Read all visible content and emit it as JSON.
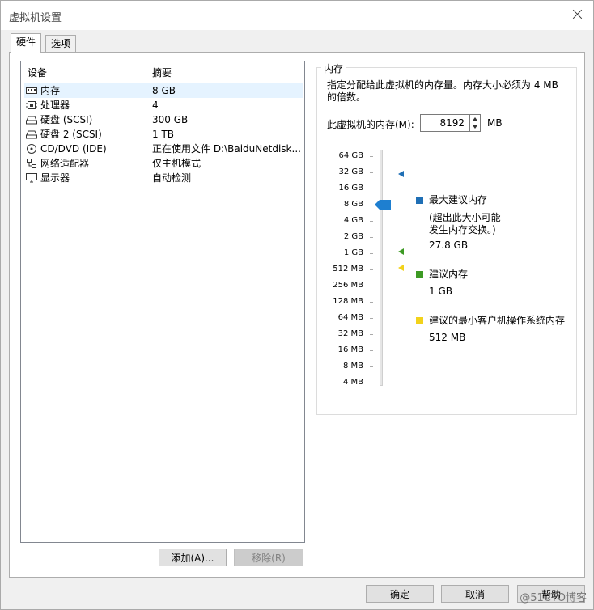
{
  "window": {
    "title": "虚拟机设置"
  },
  "tabs": [
    {
      "label": "硬件"
    },
    {
      "label": "选项"
    }
  ],
  "device_list": {
    "headers": {
      "device": "设备",
      "summary": "摘要"
    },
    "rows": [
      {
        "icon": "memory-icon",
        "device": "内存",
        "summary": "8 GB"
      },
      {
        "icon": "cpu-icon",
        "device": "处理器",
        "summary": "4"
      },
      {
        "icon": "disk-icon",
        "device": "硬盘 (SCSI)",
        "summary": "300 GB"
      },
      {
        "icon": "disk-icon",
        "device": "硬盘 2 (SCSI)",
        "summary": "1 TB"
      },
      {
        "icon": "cd-icon",
        "device": "CD/DVD (IDE)",
        "summary": "正在使用文件 D:\\BaiduNetdisk..."
      },
      {
        "icon": "network-icon",
        "device": "网络适配器",
        "summary": "仅主机模式"
      },
      {
        "icon": "display-icon",
        "device": "显示器",
        "summary": "自动检测"
      }
    ]
  },
  "list_buttons": {
    "add": "添加(A)...",
    "remove": "移除(R)"
  },
  "memory": {
    "group_title": "内存",
    "description": "指定分配给此虚拟机的内存量。内存大小必须为 4 MB 的倍数。",
    "label": "此虚拟机的内存(M):",
    "value": "8192",
    "unit": "MB",
    "scale_ticks": [
      "64 GB",
      "32 GB",
      "16 GB",
      "8 GB",
      "4 GB",
      "2 GB",
      "1 GB",
      "512 MB",
      "256 MB",
      "128 MB",
      "64 MB",
      "32 MB",
      "16 MB",
      "8 MB",
      "4 MB"
    ],
    "legend": {
      "max_title": "最大建议内存",
      "max_note_line1": "(超出此大小可能",
      "max_note_line2": "发生内存交换。)",
      "max_value": "27.8 GB",
      "rec_title": "建议内存",
      "rec_value": "1 GB",
      "min_title": "建议的最小客户机操作系统内存",
      "min_value": "512 MB"
    },
    "colors": {
      "max": "#1f6fb5",
      "recommended": "#3d9a24",
      "minimum": "#f2d21b",
      "thumb": "#1e7fd0"
    }
  },
  "footer": {
    "ok": "确定",
    "cancel": "取消",
    "help": "帮助"
  },
  "watermark": "@51CTO博客"
}
